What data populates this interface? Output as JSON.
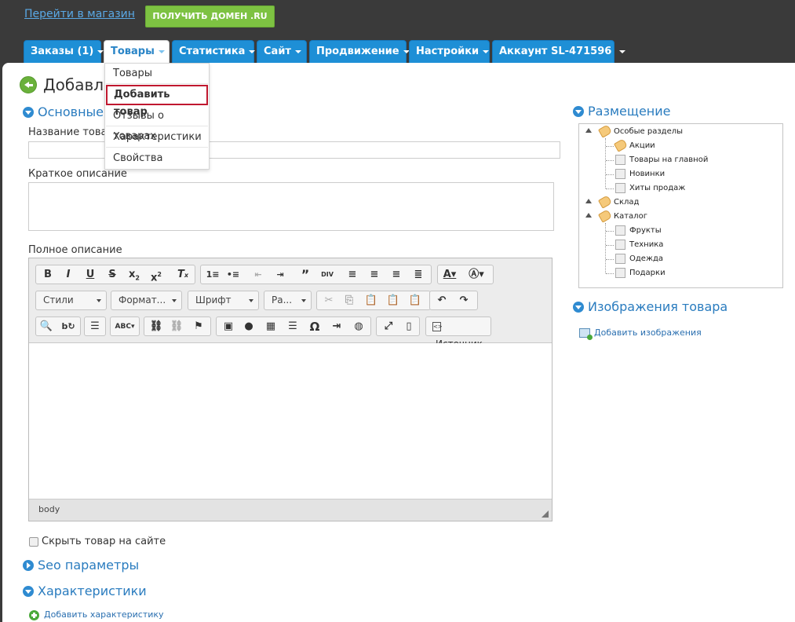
{
  "header": {
    "shop_link": "Перейти в магазин",
    "domain_button": "ПОЛУЧИТЬ ДОМЕН .RU"
  },
  "tabs": [
    {
      "label": "Заказы (1)"
    },
    {
      "label": "Товары"
    },
    {
      "label": "Статистика"
    },
    {
      "label": "Сайт"
    },
    {
      "label": "Продвижение"
    },
    {
      "label": "Настройки"
    },
    {
      "label": "Аккаунт SL-471596"
    }
  ],
  "dropdown": {
    "items": [
      "Товары",
      "Добавить товар",
      "Отзывы о товарах",
      "Характеристики",
      "Свойства"
    ]
  },
  "page": {
    "title": "Добавление товара"
  },
  "main": {
    "section_basic": "Основные",
    "name_label": "Название товара",
    "name_value": "",
    "short_desc_label": "Краткое описание",
    "full_desc_label": "Полное описание",
    "hide_label": "Скрыть товар на сайте",
    "seo_title": "Seo параметры",
    "chars_title": "Характеристики",
    "add_char_link": "Добавить характеристику"
  },
  "editor": {
    "styles_combo": "Стили",
    "format_combo": "Формат...",
    "font_combo": "Шрифт",
    "size_combo": "Ра...",
    "source_button": "Источник",
    "status_path": "body"
  },
  "sidebar": {
    "placement_title": "Размещение",
    "tree": [
      {
        "label": "Особые разделы",
        "type": "folder"
      },
      {
        "label": "Акции",
        "type": "folder"
      },
      {
        "label": "Товары на главной",
        "type": "leaf"
      },
      {
        "label": "Новинки",
        "type": "leaf"
      },
      {
        "label": "Хиты продаж",
        "type": "leaf"
      },
      {
        "label": "Склад",
        "type": "folder"
      },
      {
        "label": "Каталог",
        "type": "folder"
      },
      {
        "label": "Фрукты",
        "type": "leaf"
      },
      {
        "label": "Техника",
        "type": "leaf"
      },
      {
        "label": "Одежда",
        "type": "leaf"
      },
      {
        "label": "Подарки",
        "type": "leaf"
      }
    ],
    "images_title": "Изображения товара",
    "add_images_link": "Добавить изображения"
  },
  "colors": {
    "tab_blue": "#1e8fd6",
    "accent_green": "#7dc242",
    "link_blue": "#2a7cbf",
    "highlight_red": "#c0182f"
  }
}
